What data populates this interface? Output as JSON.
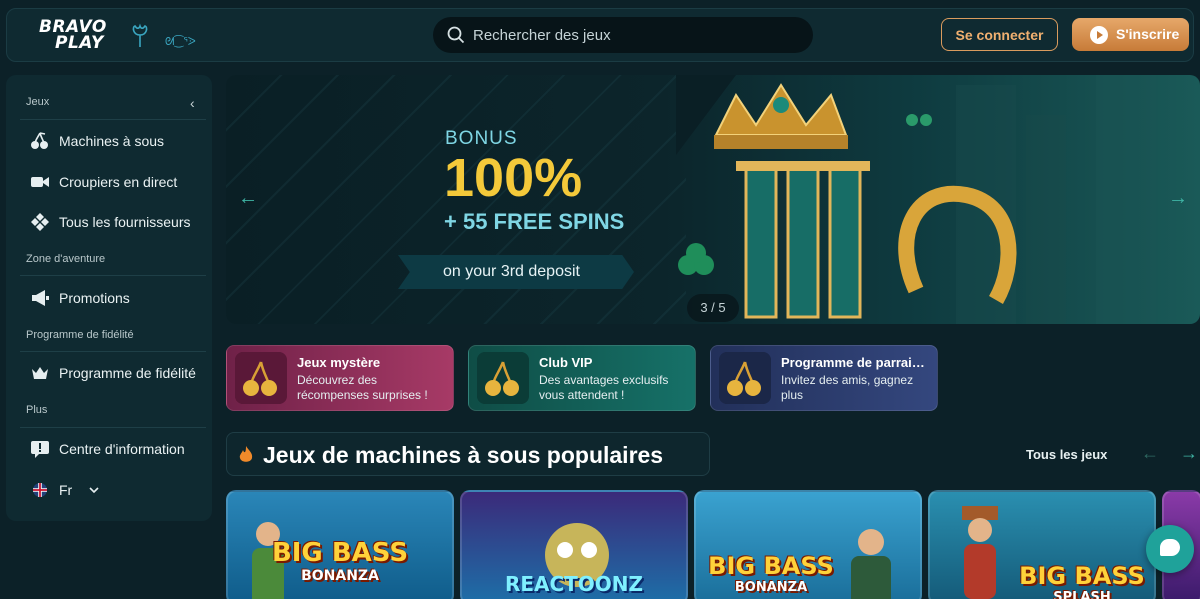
{
  "header": {
    "logo_line1": "BRAVO",
    "logo_line2": "PLAY",
    "search_placeholder": "Rechercher des jeux",
    "login_label": "Se connecter",
    "register_label": "S'inscrire"
  },
  "sidebar": {
    "sections": [
      {
        "label": "Jeux"
      },
      {
        "label": "Zone d'aventure"
      },
      {
        "label": "Programme de fidélité"
      },
      {
        "label": "Plus"
      }
    ],
    "items": [
      {
        "label": "Machines à sous",
        "icon": "cherries-icon"
      },
      {
        "label": "Croupiers en direct",
        "icon": "video-camera-icon"
      },
      {
        "label": "Tous les fournisseurs",
        "icon": "diamonds-icon"
      },
      {
        "label": "Promotions",
        "icon": "megaphone-icon"
      },
      {
        "label": "Programme de fidélité",
        "icon": "crown-icon"
      },
      {
        "label": "Centre d'information",
        "icon": "info-bubble-icon"
      },
      {
        "label": "Fr",
        "icon": "uk-flag-icon"
      }
    ]
  },
  "banner": {
    "bonus": "BONUS",
    "percent": "100%",
    "spins": "+ 55 FREE SPINS",
    "deposit": "on your 3rd deposit",
    "pagination": "3 / 5"
  },
  "promos": [
    {
      "title": "Jeux mystère",
      "desc": "Découvrez des récompenses surprises !",
      "color": "#8a2a55"
    },
    {
      "title": "Club VIP",
      "desc": "Des avantages exclusifs vous attendent !",
      "color": "#136158"
    },
    {
      "title": "Programme de parrainage",
      "desc": "Invitez des amis, gagnez plus",
      "color": "#2c3c6c"
    }
  ],
  "games_section": {
    "title": "Jeux de machines à sous populaires",
    "all_games": "Tous les jeux"
  },
  "games": [
    {
      "name_top": "BIG BASS",
      "name_bottom": "BONANZA"
    },
    {
      "name_top": "REACTOONZ",
      "name_bottom": ""
    },
    {
      "name_top": "BIG BASS",
      "name_bottom": "BONANZA"
    },
    {
      "name_top": "BIG BASS",
      "name_bottom": "SPLASH"
    }
  ],
  "colors": {
    "accent": "#f0b070",
    "teal": "#3fb5a5",
    "gold": "#f4c93a"
  }
}
